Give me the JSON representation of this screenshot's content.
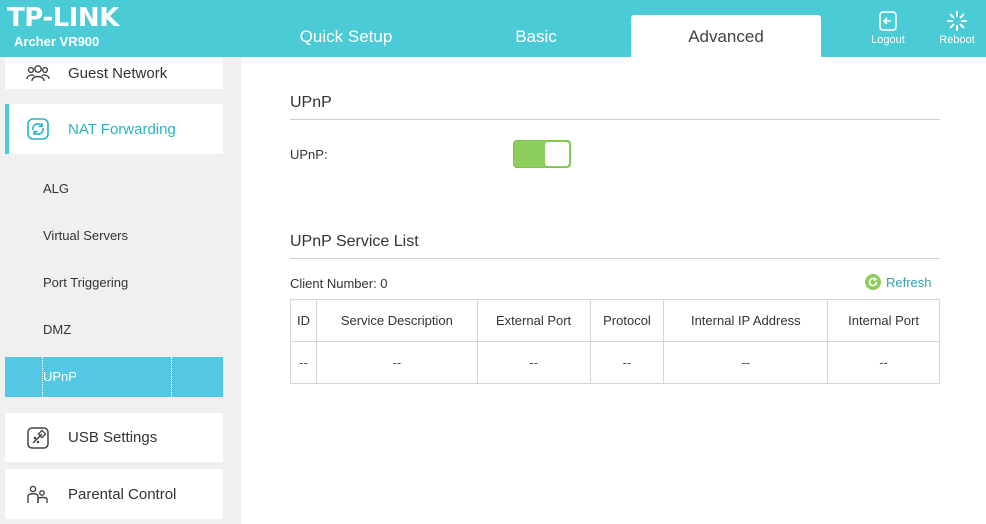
{
  "header": {
    "logo": "TP-LINK",
    "model": "Archer VR900",
    "tabs": [
      {
        "label": "Quick Setup"
      },
      {
        "label": "Basic"
      },
      {
        "label": "Advanced",
        "active": true
      }
    ],
    "logout_label": "Logout",
    "reboot_label": "Reboot",
    "accent_color": "#4acbd6"
  },
  "sidebar": {
    "items": [
      {
        "label": "Guest Network",
        "icon": "guest-network-icon"
      },
      {
        "label": "NAT Forwarding",
        "icon": "nat-forwarding-icon",
        "active": true
      },
      {
        "label": "USB Settings",
        "icon": "usb-settings-icon"
      },
      {
        "label": "Parental Control",
        "icon": "parental-control-icon"
      }
    ],
    "subitems": [
      {
        "label": "ALG"
      },
      {
        "label": "Virtual Servers"
      },
      {
        "label": "Port Triggering"
      },
      {
        "label": "DMZ"
      },
      {
        "label": "UPnP",
        "active": true
      }
    ]
  },
  "main": {
    "upnp_title": "UPnP",
    "upnp_field_label": "UPnP:",
    "upnp_enabled": true,
    "list_title": "UPnP Service List",
    "client_number": "Client Number: 0",
    "refresh_label": "Refresh",
    "table": {
      "headers": [
        "ID",
        "Service Description",
        "External Port",
        "Protocol",
        "Internal IP Address",
        "Internal Port"
      ],
      "rows": [
        [
          "--",
          "--",
          "--",
          "--",
          "--",
          "--"
        ]
      ]
    }
  }
}
